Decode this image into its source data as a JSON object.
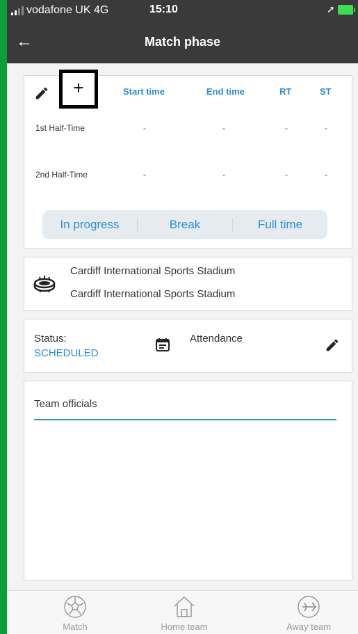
{
  "status_bar": {
    "carrier": "vodafone UK  4G",
    "time": "15:10",
    "location_icon": "location-arrow-icon",
    "battery_icon": "battery-charging-icon"
  },
  "header": {
    "title": "Match phase",
    "back_icon": "arrow-left-icon"
  },
  "phase_card": {
    "columns": [
      "Start time",
      "End time",
      "RT",
      "ST"
    ],
    "rows": [
      {
        "label": "1st Half-Time",
        "cells": [
          "-",
          "-",
          "-",
          "-"
        ]
      },
      {
        "label": "2nd Half-Time",
        "cells": [
          "-",
          "-",
          "-",
          "-"
        ]
      }
    ],
    "add_label": "+",
    "segments": [
      "In progress",
      "Break",
      "Full time"
    ]
  },
  "venue": {
    "line1": "Cardiff International Sports Stadium",
    "line2": "Cardiff International Sports Stadium"
  },
  "status_card": {
    "label": "Status:",
    "value": "SCHEDULED",
    "attendance_label": "Attendance"
  },
  "officials": {
    "label": "Team officials"
  },
  "nav": [
    {
      "label": "Match",
      "icon": "football-icon"
    },
    {
      "label": "Home team",
      "icon": "home-icon"
    },
    {
      "label": "Away team",
      "icon": "airplane-icon"
    }
  ],
  "colors": {
    "accent": "#2a8fd8",
    "header_bg": "#3a3a3a",
    "frame": "#0f9d3a"
  }
}
